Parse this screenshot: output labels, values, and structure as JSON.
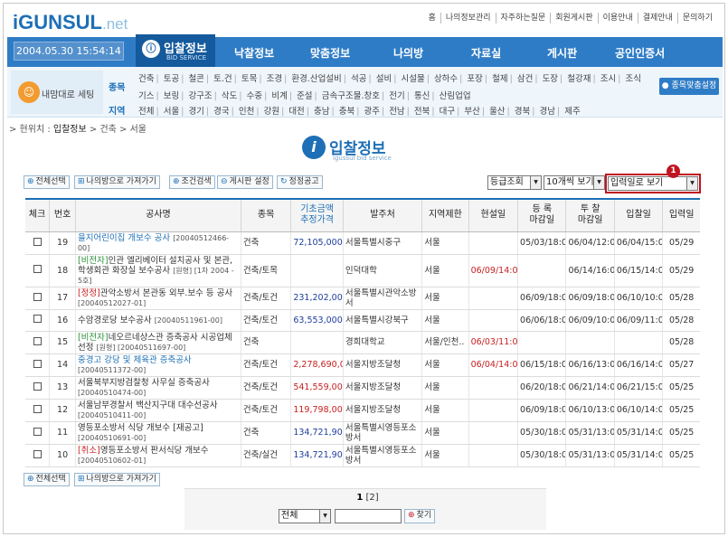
{
  "header": {
    "logo": "iGUNSUL",
    "logo_suffix": ".net",
    "top_links": [
      "홈",
      "나의정보관리",
      "자주하는질문",
      "회원게시판",
      "이용안내",
      "결제안내",
      "문의하기"
    ]
  },
  "mainbar": {
    "datetime": "2004.05.30 15:54:14",
    "active_tab": "입찰정보",
    "active_tab_sub": "BID SERVICE",
    "tabs": [
      "낙찰정보",
      "맞춤정보",
      "나의방",
      "자료실",
      "게시판",
      "공인인증서"
    ]
  },
  "subbar": {
    "user_button": "내맘대로 세팅",
    "row1_label": "종목",
    "row1": [
      "건축",
      "토공",
      "철콘",
      "토.건",
      "토목",
      "조경",
      "환경.산업설비",
      "석공",
      "설비",
      "시설물",
      "상하수",
      "포장",
      "철제",
      "삼건",
      "도장",
      "철강재",
      "조시",
      "조식"
    ],
    "row2": [
      "기스",
      "보링",
      "강구조",
      "삭도",
      "수중",
      "비계",
      "준설",
      "금속구조물.창호",
      "전기",
      "통신",
      "산림업업"
    ],
    "row3_label": "지역",
    "row3": [
      "전체",
      "서울",
      "경기",
      "경국",
      "인천",
      "강원",
      "대전",
      "충남",
      "충북",
      "광주",
      "전남",
      "전북",
      "대구",
      "부산",
      "울산",
      "경북",
      "경남",
      "제주"
    ],
    "custom_button": "종목맞춤설정"
  },
  "breadcrumb": {
    "prefix": "> 현위치 : ",
    "current": "입찰정보",
    "rest": " > 건축 > 서울"
  },
  "page_title": {
    "title": "입찰정보",
    "subtitle": "igussul bid service"
  },
  "toolbar": {
    "select_all": "전체선택",
    "to_mypage": "나의방으로 가져가기",
    "condition_search": "조건검색",
    "board_setting": "게시판 설정",
    "notice": "정정공고",
    "sort_select": "등급조회",
    "page_size": "10개씩 보기",
    "view_mode": "입력일로 보기",
    "callout": "1"
  },
  "table": {
    "headers": [
      "체크",
      "번호",
      "공사명",
      "종목",
      "기초금액\n추정가격",
      "발주처",
      "지역제한",
      "현설일",
      "등 록\n마감일",
      "투 찰\n마감일",
      "입찰일",
      "입력일"
    ],
    "rows": [
      {
        "no": "19",
        "prefix": "",
        "title": "을지어린이집 개보수 공사",
        "code": "[20040512466-00]",
        "type": "건축",
        "amount": "72,105,000",
        "amt_red": false,
        "org": "서울특별시중구",
        "region": "서울",
        "site": "",
        "reg": "05/03/18:00",
        "bid_close": "06/04/12:00",
        "bid": "06/04/15:00",
        "input": "05/29",
        "title_blue": true
      },
      {
        "no": "18",
        "prefix": "[비전자]",
        "title": "인관 엘리베이터 설치공사 및 본관, 학생회관 화장실 보수공사",
        "code": "[원형] [1차 2004 - 5호]",
        "type": "건축/토목",
        "amount": "",
        "amt_red": false,
        "org": "인덕대학",
        "region": "서울",
        "site": "06/09/14:00",
        "reg": "",
        "bid_close": "06/14/16:00",
        "bid": "06/15/14:00",
        "input": "05/29",
        "title_blue": false
      },
      {
        "no": "17",
        "prefix": "[정정]",
        "title": "관악소방서 본관동 외부.보수 등 공사",
        "code": "[20040512027-01]",
        "type": "건축/토건",
        "amount": "231,202,000",
        "amt_red": false,
        "org": "서울특별시관악소방서",
        "region": "서울",
        "site": "",
        "reg": "06/09/18:00",
        "bid_close": "06/09/18:00",
        "bid": "06/10/10:00",
        "input": "05/28",
        "title_blue": false
      },
      {
        "no": "16",
        "prefix": "",
        "title": "수암경로당 보수공사",
        "code": "[20040511961-00]",
        "type": "건축/토건",
        "amount": "63,553,000",
        "amt_red": false,
        "org": "서울특별시강북구",
        "region": "서울",
        "site": "",
        "reg": "06/06/18:00",
        "bid_close": "06/09/10:00",
        "bid": "06/09/11:00",
        "input": "05/28",
        "title_blue": false
      },
      {
        "no": "15",
        "prefix": "[비전자]",
        "title": "네오르네상스관 증축공사 시공업체선정",
        "code": "[원형] [20040511697-00]",
        "type": "건축",
        "amount": "",
        "amt_red": false,
        "org": "경희대학교",
        "region": "서울/인천..",
        "site": "06/03/11:00",
        "reg": "",
        "bid_close": "",
        "bid": "",
        "input": "05/28",
        "title_blue": false
      },
      {
        "no": "14",
        "prefix": "",
        "title": "중경고 강당 및 체육관 증축공사",
        "code": "[20040511372-00]",
        "type": "건축/토건",
        "amount": "2,278,690,000",
        "amt_red": true,
        "org": "서울지방조달청",
        "region": "서울",
        "site": "06/04/14:00",
        "reg": "06/15/18:00",
        "bid_close": "06/16/13:00",
        "bid": "06/16/14:00",
        "input": "05/27",
        "title_blue": true
      },
      {
        "no": "13",
        "prefix": "",
        "title": "서울북부지방검찰청 사무실 증축공사",
        "code": "[20040510474-00]",
        "type": "건축/토건",
        "amount": "541,559,000",
        "amt_red": true,
        "org": "서울지방조달청",
        "region": "서울",
        "site": "",
        "reg": "06/20/18:00",
        "bid_close": "06/21/14:00",
        "bid": "06/21/15:00",
        "input": "05/25",
        "title_blue": false
      },
      {
        "no": "12",
        "prefix": "",
        "title": "서울남부경찰서 백산지구대 대수선공사",
        "code": "[20040510411-00]",
        "type": "건축/토건",
        "amount": "119,798,000",
        "amt_red": true,
        "org": "서울지방조달청",
        "region": "서울",
        "site": "",
        "reg": "06/09/18:00",
        "bid_close": "06/10/13:00",
        "bid": "06/10/14:00",
        "input": "05/25",
        "title_blue": false
      },
      {
        "no": "11",
        "prefix": "",
        "title": "영등포소방서 식당 개보수 [재공고]",
        "code": "[20040510691-00]",
        "type": "건축",
        "amount": "134,721,900",
        "amt_red": false,
        "org": "서울특별시영등포소방서",
        "region": "서울",
        "site": "",
        "reg": "05/30/18:00",
        "bid_close": "05/31/13:00",
        "bid": "05/31/14:00",
        "input": "05/25",
        "title_blue": false
      },
      {
        "no": "10",
        "prefix": "[취소]",
        "title": "영등포소방서 판서식당 개보수",
        "code": "[20040510602-01]",
        "type": "건축/실건",
        "amount": "134,721,900",
        "amt_red": false,
        "org": "서울특별시영등포소방서",
        "region": "서울",
        "site": "",
        "reg": "05/30/18:00",
        "bid_close": "05/31/13:00",
        "bid": "05/31/14:00",
        "input": "05/25",
        "title_blue": false
      }
    ]
  },
  "bottom": {
    "select_all": "전체선택",
    "to_mypage": "나의방으로 가져가기",
    "page_current": "1",
    "page_other": "[2]",
    "search_select": "전체",
    "search_button": "찾기"
  },
  "colors": {
    "brand": "#2f7cc6",
    "accent_red": "#c0141f",
    "dark_tab": "#145a9c"
  }
}
